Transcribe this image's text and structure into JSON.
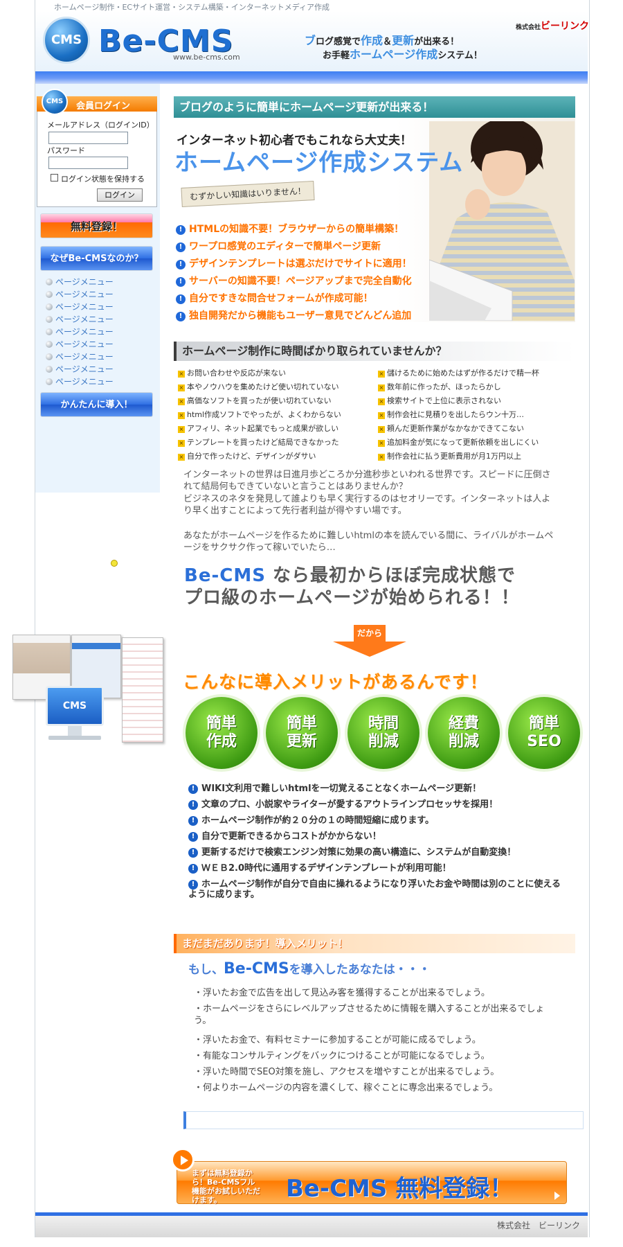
{
  "header": {
    "tagline": "ホームページ制作・ECサイト運営・システム構築・インターネットメディア作成",
    "logo_mark": "CMS",
    "logo_text": "Be-CMS",
    "logo_url": "www.be-cms.com",
    "copy_line1_a": "ブ",
    "copy_line1_b": "ログ感覚で",
    "copy_line1_c": "作成",
    "copy_line1_d": "＆",
    "copy_line1_e": "更新",
    "copy_line1_f": "が出来る！",
    "copy_line2_a": "お手軽",
    "copy_line2_b": "ホームページ作成",
    "copy_line2_c": "システム！",
    "company_prefix": "株式会社",
    "company_name": "ビーリンク"
  },
  "login": {
    "mark": "CMS",
    "title": "会員ログイン",
    "email_label": "メールアドレス（ログインID）",
    "password_label": "パスワード",
    "remember_label": "ログイン状態を保持する",
    "submit_label": "ログイン"
  },
  "sidebar": {
    "free_register": "無料登録！",
    "why": "なぜBe-CMSなのか？",
    "menu": [
      "ページメニュー",
      "ページメニュー",
      "ページメニュー",
      "ページメニュー",
      "ページメニュー",
      "ページメニュー",
      "ページメニュー",
      "ページメニュー",
      "ページメニュー"
    ],
    "easy_intro": "かんたんに導入！",
    "cms_monitor": "CMS"
  },
  "hero": {
    "bar": "ブログのように簡単にホームページ更新が出来る！",
    "sub": "インターネット初心者でもこれなら大丈夫！",
    "title": "ホームページ作成システム",
    "tag": "むずかしい知識はいりません！",
    "bullets": [
      "HTMLの知識不要！ブラウザーからの簡単構築！",
      "ワープロ感覚のエディターで簡単ページ更新",
      "デザインテンプレートは選ぶだけでサイトに適用！",
      "サーバーの知識不要！ページアップまで完全自動化",
      "自分ですきな問合せフォームが作成可能！",
      "独自開発だから機能もユーザー意見でどんどん追加"
    ]
  },
  "problems": {
    "bar": "ホームページ制作に時間ばかり取られていませんか？",
    "left": [
      "お問い合わせや反応が来ない",
      "本やノウハウを集めたけど使い切れていない",
      "高価なソフトを買ったが使い切れていない",
      "html作成ソフトでやったが、よくわからない",
      "アフィリ、ネット起業でもっと成果が欲しい",
      "テンプレートを買ったけど結局できなかった",
      "自分で作ったけど、デザインがダサい"
    ],
    "right": [
      "儲けるために始めたはずが作るだけで精一杯",
      "数年前に作ったが、ほったらかし",
      "検索サイトで上位に表示されない",
      "制作会社に見積りを出したらウン十万…",
      "頼んだ更新作業がなかなかできてこない",
      "追加料金が気になって更新依頼を出しにくい",
      "制作会社に払う更新費用が月1万円以上"
    ]
  },
  "story": {
    "p1": "インターネットの世界は日進月歩どころか分進秒歩といわれる世界です。スピードに圧倒されて結局何もできていないと言うことはありませんか？",
    "p2": "ビジネスのネタを発見して誰よりも早く実行するのはセオリーです。インターネットは人より早く出すことによって先行者利益が得やすい場です。",
    "p3": "あなたがホームページを作るために難しいhtmlの本を読んでいる間に、ライバルがホームページをサクサク作って稼いでいたら…",
    "big_brand": "Be-CMS",
    "big_line1": " なら最初からほぼ完成状態で",
    "big_line2": "プロ級のホームページが始められる！！",
    "arrow": "だから"
  },
  "merits": {
    "title": "こんなに導入メリットがあるんです！",
    "badges": [
      {
        "l1": "簡単",
        "l2": "作成"
      },
      {
        "l1": "簡単",
        "l2": "更新"
      },
      {
        "l1": "時間",
        "l2": "削減"
      },
      {
        "l1": "経費",
        "l2": "削減"
      },
      {
        "l1": "簡単",
        "l2": "SEO"
      }
    ],
    "list": [
      "WIKI文利用で難しいhtmlを一切覚えることなくホームページ更新！",
      "文章のプロ、小説家やライターが愛するアウトラインプロセッサを採用！",
      "ホームページ制作が約２０分の１の時間短縮に成ります。",
      "自分で更新できるからコストがかからない！",
      "更新するだけで検索エンジン対策に効果の高い構造に、システムが自動変換！",
      "ＷＥＢ2.0時代に通用するデザインテンプレートが利用可能！",
      "ホームページ制作が自分で自由に操れるようになり浮いたお金や時間は別のことに使えるように成ります。"
    ]
  },
  "more": {
    "bar": "まだまだあります！導入メリット！",
    "moshi_a": "もし、",
    "moshi_brand": "Be-CMS",
    "moshi_b": "を導入したあなたは・・・",
    "list": [
      "・浮いたお金で広告を出して見込み客を獲得することが出来るでしょう。",
      "・ホームページをさらにレベルアップさせるために情報を購入することが出来るでしょう。",
      "・浮いたお金で、有料セミナーに参加することが可能に成るでしょう。",
      "・有能なコンサルティングをバックにつけることが可能になるでしょう。",
      "・浮いた時間でSEO対策を施し、アクセスを増やすことが出来るでしょう。",
      "・何よりホームページの内容を濃くして、稼ぐことに専念出来るでしょう。"
    ]
  },
  "cta": {
    "small": "まずは無料登録から！Be-CMSフル機能がお試しいただけます。",
    "big": "Be-CMS 無料登録！"
  },
  "footer": {
    "copyright": "株式会社　ビーリンク"
  }
}
